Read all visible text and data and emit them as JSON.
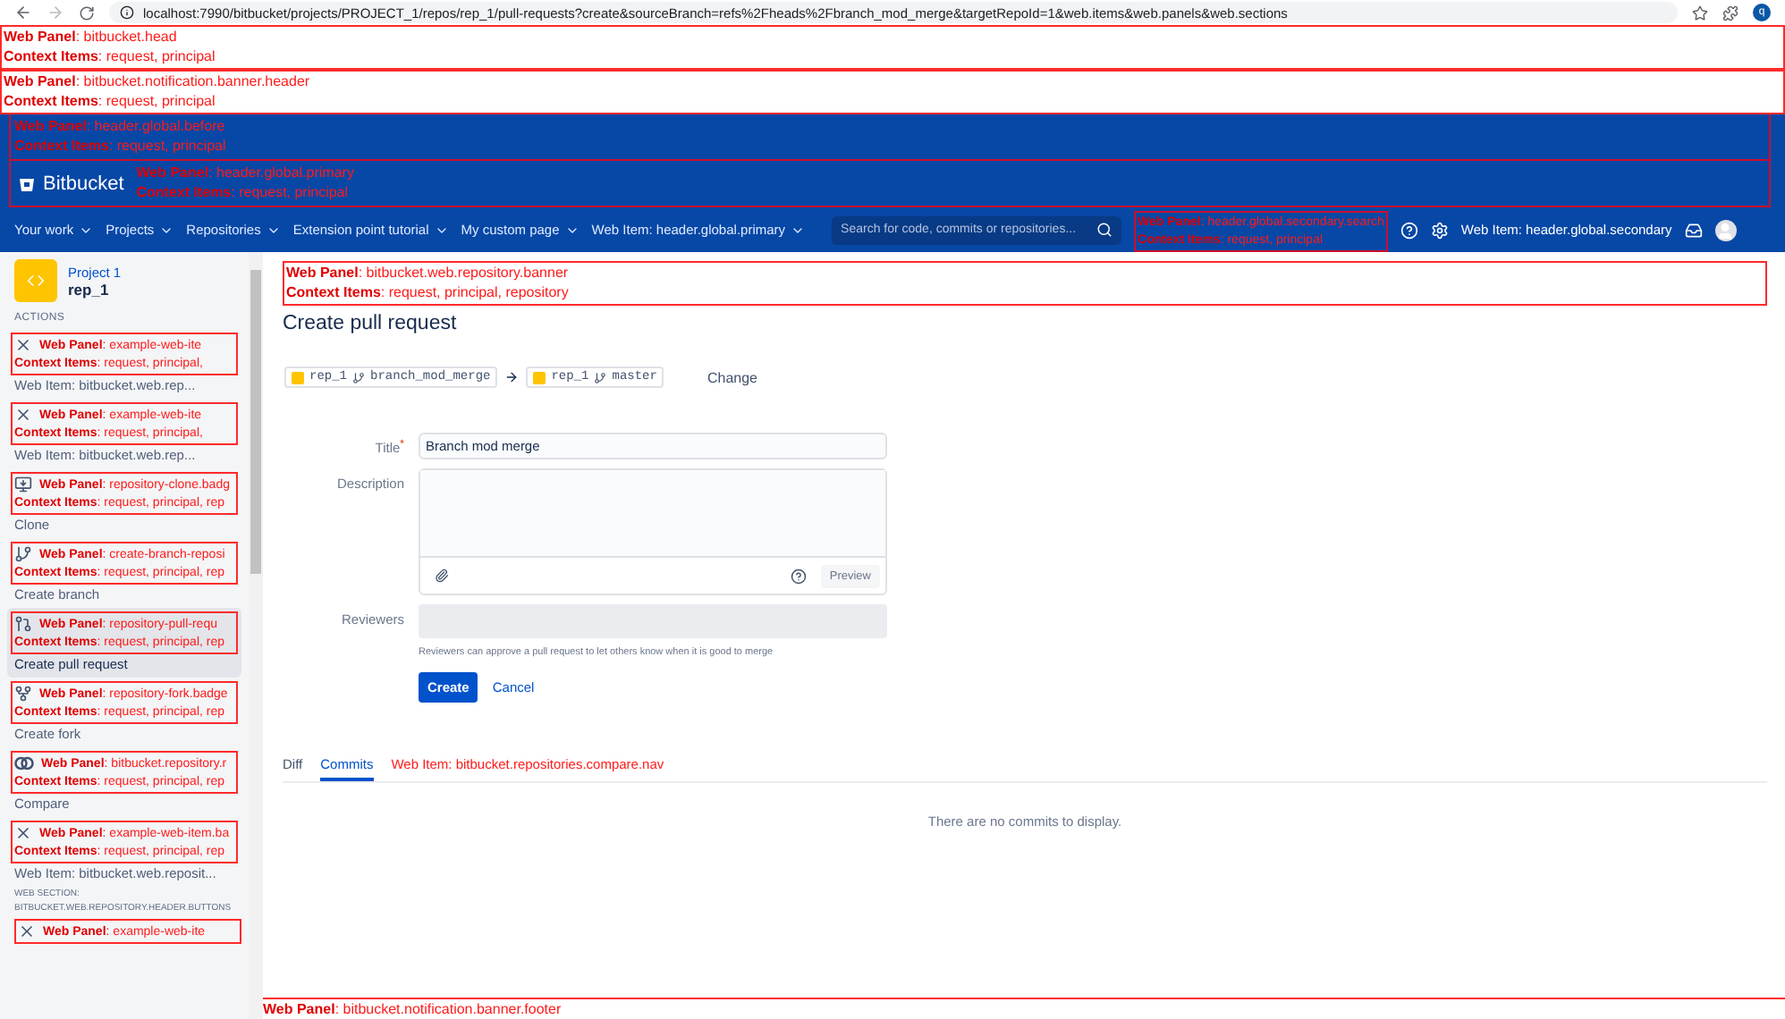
{
  "browser": {
    "url": "localhost:7990/bitbucket/projects/PROJECT_1/repos/rep_1/pull-requests?create&sourceBranch=refs%2Fheads%2Fbranch_mod_merge&targetRepoId=1&web.items&web.panels&web.sections",
    "profile": "q"
  },
  "top_panels": [
    {
      "panel": "**Web Panel**: bitbucket.head",
      "context": "**Context Items**: request, principal"
    },
    {
      "panel": "**Web Panel**: bitbucket.notification.banner.header",
      "context": "**Context Items**: request, principal"
    }
  ],
  "header": {
    "before_panel": {
      "panel": "**Web Panel**: header.global.before",
      "context": "**Context Items**: request, principal"
    },
    "logo": "Bitbucket",
    "primary_panel": {
      "panel": "**Web Panel**: header.global.primary",
      "context": "**Context Items**: request, principal"
    },
    "nav": [
      {
        "label": "Your work"
      },
      {
        "label": "Projects"
      },
      {
        "label": "Repositories"
      },
      {
        "label": "Extension point tutorial"
      },
      {
        "label": "My custom page"
      },
      {
        "label": "Web Item: header.global.primary"
      }
    ],
    "search": {
      "placeholder": "Search for code, commits or repositories..."
    },
    "search_panel": {
      "panel": "**Web Panel**: header.global.secondary.search",
      "context": "**Context Items**: request, principal"
    },
    "secondary_item": "Web Item: header.global.secondary"
  },
  "sidebar": {
    "project": "Project 1",
    "repo": "rep_1",
    "actions_heading": "ACTIONS",
    "items": [
      {
        "kind": "close",
        "panel": "**Web Panel**: example-web-ite",
        "context": "**Context Items**: request, principal,",
        "label": "Web Item: bitbucket.web.rep...",
        "selected": false
      },
      {
        "kind": "close",
        "panel": "**Web Panel**: example-web-ite",
        "context": "**Context Items**: request, principal,",
        "label": "Web Item: bitbucket.web.rep...",
        "selected": false
      },
      {
        "kind": "clone",
        "panel": "**Web Panel**: repository-clone.badg",
        "context": "**Context Items**: request, principal, rep",
        "label": "Clone",
        "selected": false
      },
      {
        "kind": "branch",
        "panel": "**Web Panel**: create-branch-reposi",
        "context": "**Context Items**: request, principal, rep",
        "label": "Create branch",
        "selected": false
      },
      {
        "kind": "pull-request",
        "panel": "**Web Panel**: repository-pull-requ",
        "context": "**Context Items**: request, principal, rep",
        "label": "Create pull request",
        "selected": true
      },
      {
        "kind": "fork",
        "panel": "**Web Panel**: repository-fork.badge",
        "context": "**Context Items**: request, principal, rep",
        "label": "Create fork",
        "selected": false
      },
      {
        "kind": "compare",
        "panel": "**Web Panel**: bitbucket.repository.r",
        "context": "**Context Items**: request, principal, rep",
        "label": "Compare",
        "selected": false
      },
      {
        "kind": "close",
        "panel": "**Web Panel**: example-web-item.ba",
        "context": "**Context Items**: request, principal, rep",
        "label": "Web Item: bitbucket.web.reposit...",
        "selected": false
      }
    ],
    "section_heading": [
      "WEB SECTION:",
      "BITBUCKET.WEB.REPOSITORY.HEADER.BUTTONS"
    ],
    "section_panel": {
      "kind": "close",
      "panel": "**Web Panel**: example-web-ite"
    }
  },
  "main": {
    "banner_panel": {
      "panel": "**Web Panel**: bitbucket.web.repository.banner",
      "context": "**Context Items**: request, principal, repository"
    },
    "title": "Create pull request",
    "source": {
      "repo": "rep_1",
      "branch": "branch_mod_merge"
    },
    "target": {
      "repo": "rep_1",
      "branch": "master"
    },
    "change": "Change",
    "form": {
      "title_label": "Title",
      "required_mark": "*",
      "title_value": "Branch mod merge",
      "description_label": "Description",
      "preview": "Preview",
      "reviewers_label": "Reviewers",
      "reviewers_help": "Reviewers can approve a pull request to let others know when it is good to merge",
      "create": "Create",
      "cancel": "Cancel"
    },
    "tabs": [
      {
        "label": "Diff",
        "kind": "tab",
        "selected": false
      },
      {
        "label": "Commits",
        "kind": "tab",
        "selected": true
      },
      {
        "label": "Web Item: bitbucket.repositories.compare.nav",
        "kind": "web-item",
        "selected": false
      }
    ],
    "empty_message": "There are no commits to display.",
    "footer_panel": {
      "panel": "**Web Panel**: bitbucket.notification.banner.footer"
    }
  }
}
